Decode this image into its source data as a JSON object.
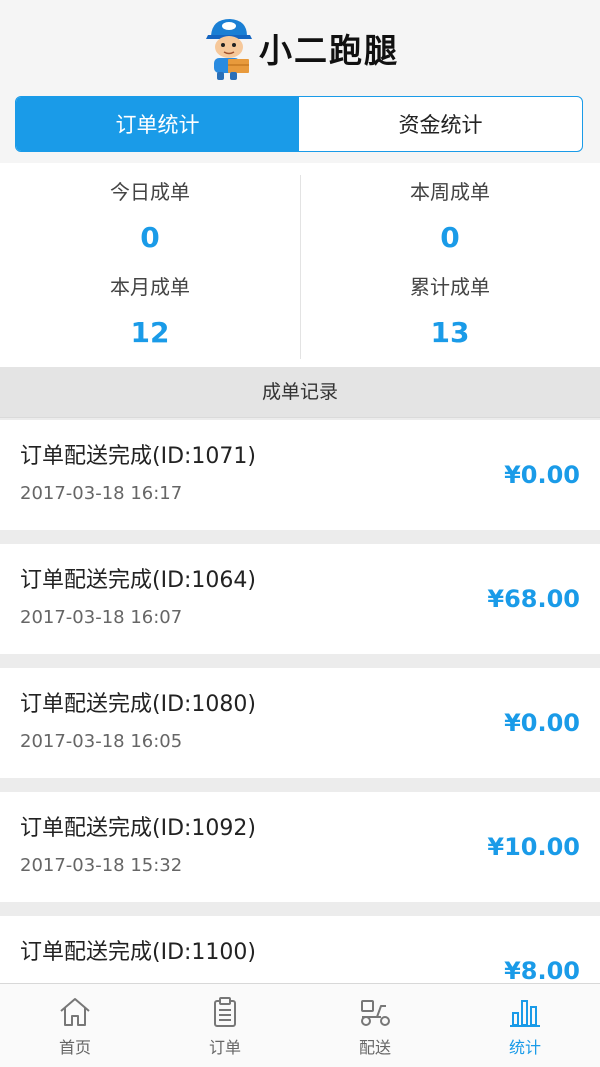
{
  "header": {
    "title": "小二跑腿",
    "logo_icon": "delivery-mascot-icon"
  },
  "tabs": [
    {
      "label": "订单统计",
      "active": true
    },
    {
      "label": "资金统计",
      "active": false
    }
  ],
  "stats": [
    {
      "label": "今日成单",
      "value": "0"
    },
    {
      "label": "本周成单",
      "value": "0"
    },
    {
      "label": "本月成单",
      "value": "12"
    },
    {
      "label": "累计成单",
      "value": "13"
    }
  ],
  "records_title": "成单记录",
  "records": [
    {
      "title": "订单配送完成(ID:1071)",
      "time": "2017-03-18 16:17",
      "amount": "¥0.00"
    },
    {
      "title": "订单配送完成(ID:1064)",
      "time": "2017-03-18 16:07",
      "amount": "¥68.00"
    },
    {
      "title": "订单配送完成(ID:1080)",
      "time": "2017-03-18 16:05",
      "amount": "¥0.00"
    },
    {
      "title": "订单配送完成(ID:1092)",
      "time": "2017-03-18 15:32",
      "amount": "¥10.00"
    },
    {
      "title": "订单配送完成(ID:1100)",
      "amount": "¥8.00"
    }
  ],
  "nav": [
    {
      "label": "首页",
      "icon": "home-icon",
      "active": false
    },
    {
      "label": "订单",
      "icon": "clipboard-icon",
      "active": false
    },
    {
      "label": "配送",
      "icon": "scooter-icon",
      "active": false
    },
    {
      "label": "统计",
      "icon": "bar-chart-icon",
      "active": true
    }
  ],
  "colors": {
    "accent": "#1a9be8",
    "section_bg": "#e4e4e4",
    "page_bg": "#ececec",
    "inactive_icon": "#777777"
  }
}
